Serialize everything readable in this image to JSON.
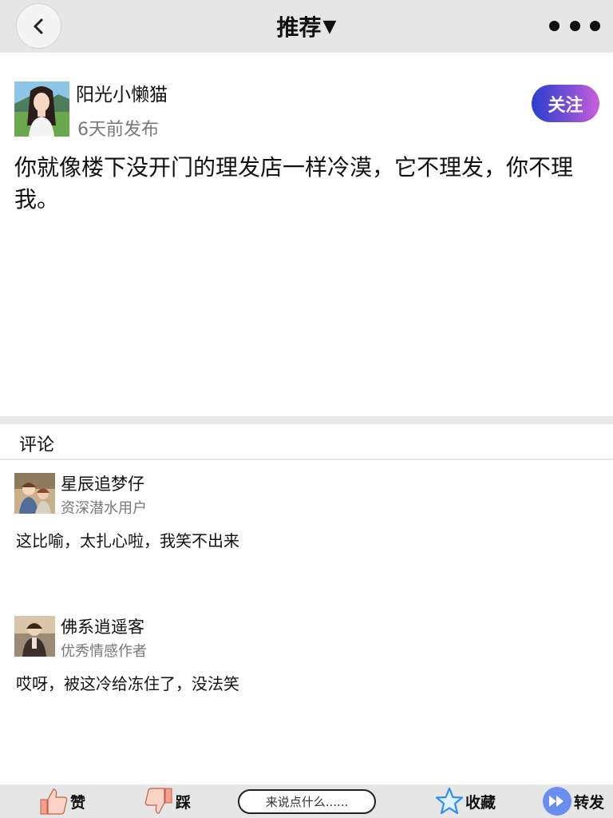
{
  "header": {
    "title": "推荐",
    "caret": "▼",
    "back_icon": "chevron-left-icon",
    "more_icon": "more-dots-icon"
  },
  "post": {
    "author": "阳光小懒猫",
    "time": "6天前发布",
    "follow_label": "关注",
    "text": "你就像楼下没开门的理发店一样冷漠，它不理发，你不理我。"
  },
  "comments": {
    "title": "评论",
    "items": [
      {
        "name": "星辰追梦仔",
        "role": "资深潜水用户",
        "text": "这比喻，太扎心啦，我笑不出来"
      },
      {
        "name": "佛系逍遥客",
        "role": "优秀情感作者",
        "text": "哎呀，被这冷给冻住了，没法笑"
      }
    ]
  },
  "bottom_bar": {
    "like_label": "赞",
    "dislike_label": "踩",
    "input_placeholder": "来说点什么......",
    "favorite_label": "收藏",
    "share_label": "转发"
  },
  "colors": {
    "topbar_bg": "#e6e6e6",
    "follow_gradient_start": "#2a3fcf",
    "follow_gradient_end": "#c95fd9",
    "star_blue": "#2f8ff0",
    "share_blue": "#6a8df0",
    "thumb_salmon": "#f4a08a"
  }
}
